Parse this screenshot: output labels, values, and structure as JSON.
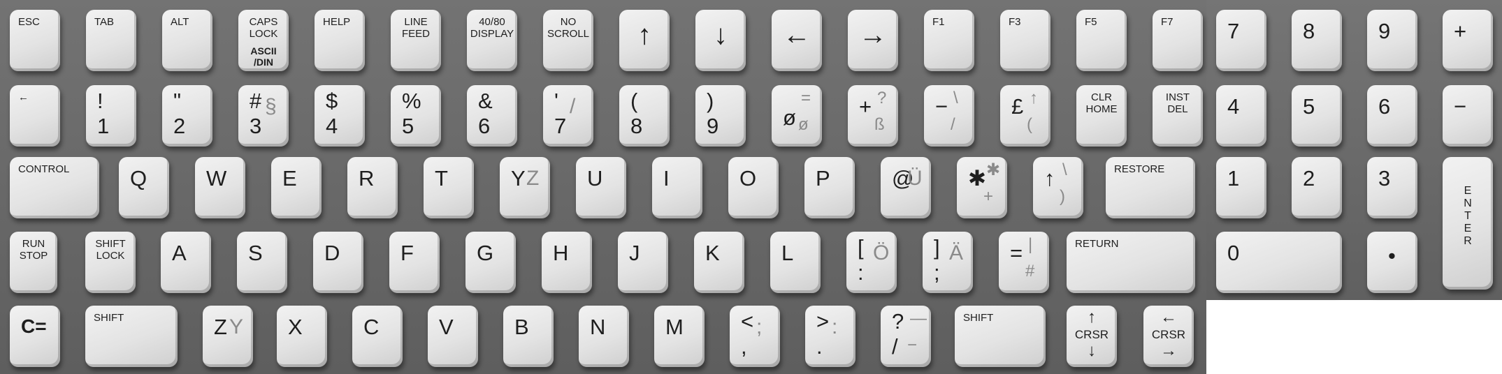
{
  "keyboard": {
    "rows": [
      {
        "name": "function-row",
        "keys": [
          {
            "id": "esc",
            "label": "ESC"
          },
          {
            "id": "tab",
            "label": "TAB"
          },
          {
            "id": "alt",
            "label": "ALT"
          },
          {
            "id": "caps-lock",
            "label": "CAPS\nLOCK",
            "sub": "ASCII\n/DIN"
          },
          {
            "id": "help",
            "label": "HELP"
          },
          {
            "id": "line-feed",
            "label": "LINE\nFEED"
          },
          {
            "id": "display-40-80",
            "label": "40/80\nDISPLAY"
          },
          {
            "id": "no-scroll",
            "label": "NO\nSCROLL"
          },
          {
            "id": "up",
            "label": "↑"
          },
          {
            "id": "down",
            "label": "↓"
          },
          {
            "id": "left",
            "label": "←"
          },
          {
            "id": "right",
            "label": "→"
          },
          {
            "id": "f1",
            "label": "F1"
          },
          {
            "id": "f3",
            "label": "F3"
          },
          {
            "id": "f5",
            "label": "F5"
          },
          {
            "id": "f7",
            "label": "F7"
          }
        ]
      },
      {
        "name": "number-row",
        "keys": [
          {
            "id": "arrow-left",
            "label": "←",
            "sub": "≷"
          },
          {
            "id": "1",
            "top": "!",
            "bottom": "1"
          },
          {
            "id": "2",
            "top": "\"",
            "bottom": "2"
          },
          {
            "id": "3",
            "top": "#",
            "bottom": "3",
            "alt": "§"
          },
          {
            "id": "4",
            "top": "$",
            "bottom": "4"
          },
          {
            "id": "5",
            "top": "%",
            "bottom": "5"
          },
          {
            "id": "6",
            "top": "&",
            "bottom": "6"
          },
          {
            "id": "7",
            "top": "'",
            "bottom": "7",
            "alt": "/"
          },
          {
            "id": "8",
            "top": "(",
            "bottom": "8"
          },
          {
            "id": "9",
            "top": ")",
            "bottom": "9"
          },
          {
            "id": "0",
            "bottom": "ø",
            "alt_top": "=",
            "alt": "ø"
          },
          {
            "id": "plus",
            "top": "+",
            "alt_top": "?",
            "alt": "ß"
          },
          {
            "id": "minus",
            "top": "−",
            "alt_top": "\\",
            "alt": "/"
          },
          {
            "id": "pound",
            "top": "£",
            "alt_top": "↑",
            "alt": "("
          },
          {
            "id": "clr-home",
            "label": "CLR\nHOME"
          },
          {
            "id": "inst-del",
            "label": "INST\nDEL"
          }
        ]
      },
      {
        "name": "qwerty-row",
        "keys": [
          {
            "id": "control",
            "label": "CONTROL"
          },
          {
            "id": "q",
            "top": "Q"
          },
          {
            "id": "w",
            "top": "W"
          },
          {
            "id": "e",
            "top": "E"
          },
          {
            "id": "r",
            "top": "R"
          },
          {
            "id": "t",
            "top": "T"
          },
          {
            "id": "y",
            "top": "Y",
            "alt": "Z"
          },
          {
            "id": "u",
            "top": "U"
          },
          {
            "id": "i",
            "top": "I"
          },
          {
            "id": "o",
            "top": "O"
          },
          {
            "id": "p",
            "top": "P"
          },
          {
            "id": "at",
            "top": "@",
            "alt": "Ü"
          },
          {
            "id": "asterisk",
            "top": "✱",
            "alt_top": "✱",
            "alt": "+"
          },
          {
            "id": "up-arrow",
            "top": "↑",
            "alt_top": "\\",
            "alt": ")"
          },
          {
            "id": "restore",
            "label": "RESTORE"
          }
        ]
      },
      {
        "name": "home-row",
        "keys": [
          {
            "id": "run-stop",
            "label": "RUN\nSTOP"
          },
          {
            "id": "shift-lock",
            "label": "SHIFT\nLOCK"
          },
          {
            "id": "a",
            "top": "A"
          },
          {
            "id": "s",
            "top": "S"
          },
          {
            "id": "d",
            "top": "D"
          },
          {
            "id": "f",
            "top": "F"
          },
          {
            "id": "g",
            "top": "G"
          },
          {
            "id": "h",
            "top": "H"
          },
          {
            "id": "j",
            "top": "J"
          },
          {
            "id": "k",
            "top": "K"
          },
          {
            "id": "l",
            "top": "L"
          },
          {
            "id": "colon",
            "top": "[",
            "bottom": ":",
            "alt": "Ö"
          },
          {
            "id": "semicolon",
            "top": "]",
            "bottom": ";",
            "alt": "Ä"
          },
          {
            "id": "equals",
            "top": "=",
            "alt_top": "|",
            "alt": "#"
          },
          {
            "id": "return",
            "label": "RETURN"
          }
        ]
      },
      {
        "name": "bottom-row",
        "keys": [
          {
            "id": "commodore",
            "top": "C="
          },
          {
            "id": "shift-left",
            "label": "SHIFT"
          },
          {
            "id": "z",
            "top": "Z",
            "alt": "Y"
          },
          {
            "id": "x",
            "top": "X"
          },
          {
            "id": "c",
            "top": "C"
          },
          {
            "id": "v",
            "top": "V"
          },
          {
            "id": "b",
            "top": "B"
          },
          {
            "id": "n",
            "top": "N"
          },
          {
            "id": "m",
            "top": "M"
          },
          {
            "id": "comma",
            "top": "<",
            "bottom": ",",
            "alt": ";"
          },
          {
            "id": "period",
            "top": ">",
            "bottom": ".",
            "alt": ":"
          },
          {
            "id": "slash",
            "top": "?",
            "bottom": "/",
            "alt_top": "—",
            "alt": "−"
          },
          {
            "id": "shift-right",
            "label": "SHIFT"
          },
          {
            "id": "crsr-updown",
            "label": "CRSR",
            "top": "↑",
            "bottom": "↓"
          },
          {
            "id": "crsr-leftright",
            "label": "CRSR",
            "top": "←",
            "bottom": "→"
          }
        ]
      }
    ],
    "numpad": [
      {
        "id": "np7",
        "top": "7"
      },
      {
        "id": "np8",
        "top": "8"
      },
      {
        "id": "np9",
        "top": "9"
      },
      {
        "id": "np-plus",
        "top": "+"
      },
      {
        "id": "np4",
        "top": "4"
      },
      {
        "id": "np5",
        "top": "5"
      },
      {
        "id": "np6",
        "top": "6"
      },
      {
        "id": "np-minus",
        "top": "−"
      },
      {
        "id": "np1",
        "top": "1"
      },
      {
        "id": "np2",
        "top": "2"
      },
      {
        "id": "np3",
        "top": "3"
      },
      {
        "id": "np-enter",
        "label": "E\nN\nT\nE\nR"
      },
      {
        "id": "np0",
        "top": "0"
      },
      {
        "id": "np-dot",
        "top": "•"
      }
    ]
  }
}
